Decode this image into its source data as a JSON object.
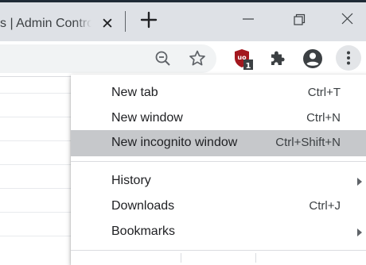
{
  "tab": {
    "title": "s | Admin Controls",
    "close_glyph": "✕"
  },
  "window_controls": [
    "minimize",
    "restore",
    "close"
  ],
  "toolbar": {
    "extension_badge": "1"
  },
  "menu": {
    "items": [
      {
        "label": "New tab",
        "shortcut": "Ctrl+T",
        "highlighted": false
      },
      {
        "label": "New window",
        "shortcut": "Ctrl+N",
        "highlighted": false
      },
      {
        "label": "New incognito window",
        "shortcut": "Ctrl+Shift+N",
        "highlighted": true
      },
      {
        "label": "History",
        "shortcut": "",
        "submenu": true
      },
      {
        "label": "Downloads",
        "shortcut": "Ctrl+J"
      },
      {
        "label": "Bookmarks",
        "shortcut": "",
        "submenu": true
      }
    ]
  },
  "colors": {
    "tabstrip": "#dee1e6",
    "highlight": "#c6c8cb",
    "ublock_red": "#a3171e"
  }
}
